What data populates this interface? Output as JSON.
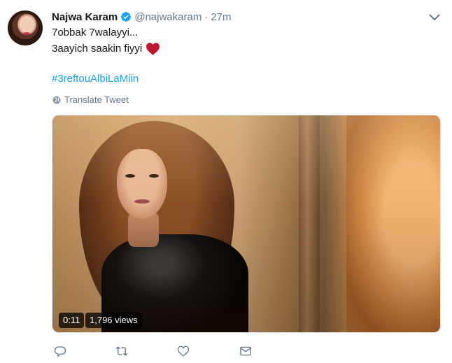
{
  "author": {
    "name": "Najwa Karam",
    "handle": "@najwakaram",
    "separator": "·",
    "time": "27m"
  },
  "tweet": {
    "line1": "7obbak 7walayyi...",
    "line2": "3aayich saakin fiyyi",
    "hashtag": "#3reftouAlbiLaMiin",
    "translate_label": "Translate Tweet"
  },
  "video": {
    "duration": "0:11",
    "views": "1,796 views"
  },
  "icons": {
    "verified": "verified-badge-icon",
    "caret": "chevron-down-icon",
    "heart_emoji": "red-heart-emoji-icon",
    "globe": "globe-icon",
    "reply": "reply-icon",
    "retweet": "retweet-icon",
    "like": "like-icon",
    "dm": "direct-message-icon"
  },
  "colors": {
    "link": "#1da1f2",
    "secondary_text": "#657786",
    "primary_text": "#14171a",
    "heart": "#e0245e"
  }
}
